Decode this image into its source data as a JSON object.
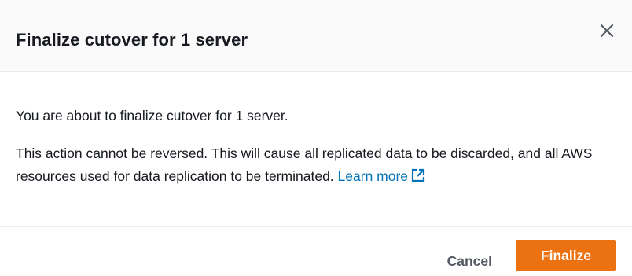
{
  "modal": {
    "title": "Finalize cutover for 1 server",
    "close_icon": "close-icon"
  },
  "body": {
    "paragraph_1": "You are about to finalize cutover for 1 server.",
    "paragraph_2": "This action cannot be reversed. This will cause all replicated data to be discarded, and all AWS resources used for data replication to be terminated.",
    "learn_more_label": "Learn more",
    "learn_more_icon": "external-link-icon"
  },
  "footer": {
    "cancel_label": "Cancel",
    "finalize_label": "Finalize"
  },
  "colors": {
    "primary_button": "#ec7211",
    "link": "#0073bb",
    "header_bg": "#fafafa",
    "text": "#16191f",
    "secondary_text": "#545b64"
  }
}
